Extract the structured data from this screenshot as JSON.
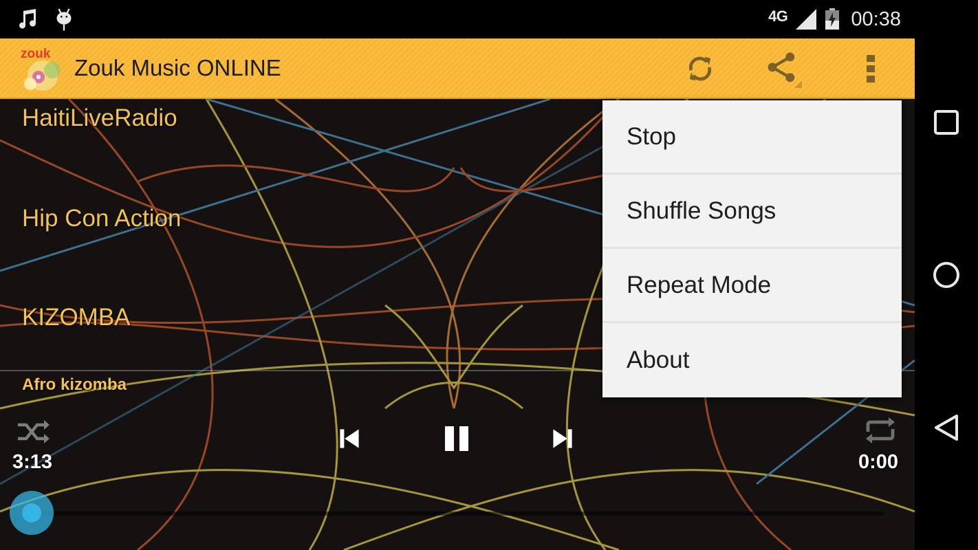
{
  "status_bar": {
    "notification_icons": [
      "music-note-icon",
      "android-debug-icon"
    ],
    "network": "4G",
    "signal_icon": "signal-icon",
    "battery_icon": "battery-charging-icon",
    "clock": "00:38"
  },
  "action_bar": {
    "logo_text": "zouk",
    "title": "Zouk Music ONLINE",
    "background_color": "#fbbd3e",
    "actions": [
      {
        "name": "refresh",
        "icon": "refresh-icon"
      },
      {
        "name": "share",
        "icon": "share-icon"
      },
      {
        "name": "overflow",
        "icon": "more-vert-icon"
      }
    ]
  },
  "stations": [
    {
      "label": "HaitiLiveRadio"
    },
    {
      "label": "Hip Con Action"
    },
    {
      "label": "KIZOMBA"
    }
  ],
  "player": {
    "now_playing": "Afro kizomba",
    "elapsed": "3:13",
    "total": "0:00",
    "progress": 0,
    "accent_color": "#33b5e5",
    "text_color": "#f3c24f",
    "controls": {
      "shuffle_icon": "shuffle-icon",
      "previous_icon": "skip-previous-icon",
      "pause_icon": "pause-icon",
      "next_icon": "skip-next-icon",
      "repeat_icon": "repeat-icon"
    }
  },
  "overflow_menu": {
    "items": [
      {
        "label": "Stop"
      },
      {
        "label": "Shuffle Songs"
      },
      {
        "label": "Repeat Mode"
      },
      {
        "label": "About"
      }
    ]
  },
  "nav_bar": {
    "buttons": [
      "recents-icon",
      "home-icon",
      "back-icon"
    ]
  }
}
